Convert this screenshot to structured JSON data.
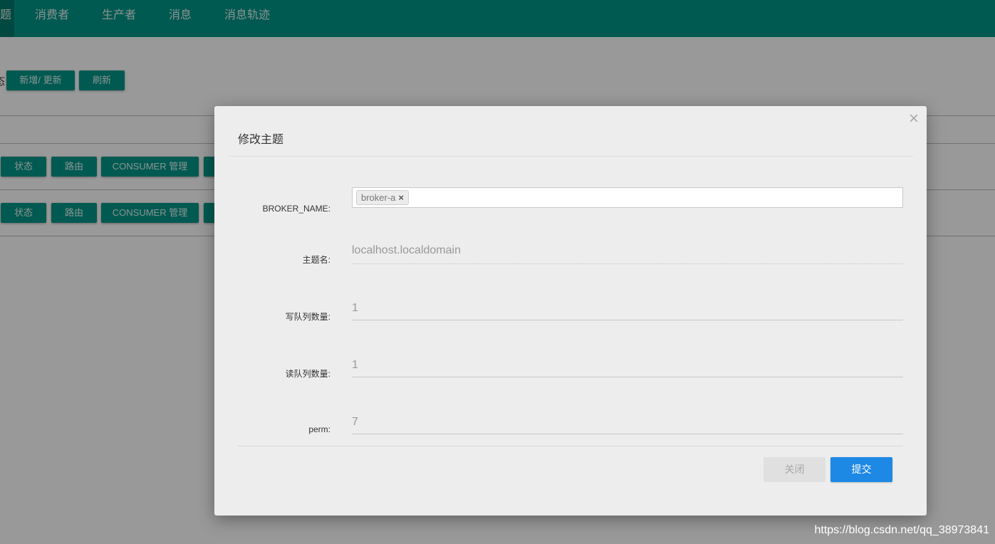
{
  "nav": {
    "partial_item": "题",
    "items": [
      "消费者",
      "生产者",
      "消息",
      "消息轨迹"
    ]
  },
  "page": {
    "partial_label": "态",
    "add_update_label": "新增/ 更新",
    "refresh_label": "刷新",
    "rows": [
      {
        "status_label": "状态",
        "route_label": "路由",
        "consumer_label": "CONSUMER 管理"
      },
      {
        "status_label": "状态",
        "route_label": "路由",
        "consumer_label": "CONSUMER 管理"
      }
    ]
  },
  "modal": {
    "title": "修改主题",
    "close_symbol": "×",
    "fields": {
      "broker_name": {
        "label": "BROKER_NAME:",
        "tag": "broker-a",
        "tag_remove": "×"
      },
      "topic_name": {
        "label": "主题名:",
        "value": "localhost.localdomain"
      },
      "write_queue": {
        "label": "写队列数量:",
        "value": "1"
      },
      "read_queue": {
        "label": "读队列数量:",
        "value": "1"
      },
      "perm": {
        "label": "perm:",
        "value": "7"
      }
    },
    "close_button_label": "关闭",
    "submit_button_label": "提交"
  },
  "watermark": "https://blog.csdn.net/qq_38973841",
  "colors": {
    "primary": "#009688",
    "submit": "#1e88e5"
  }
}
